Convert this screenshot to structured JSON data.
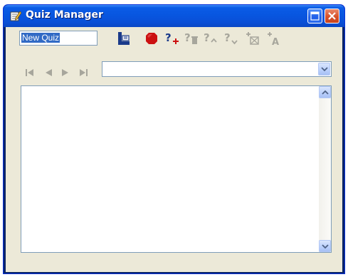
{
  "window": {
    "title": "Quiz Manager",
    "title_icon": "notepad-pencil-icon",
    "buttons": [
      "maximize",
      "close"
    ]
  },
  "quiz_name": {
    "value": "New Quiz",
    "selected": true
  },
  "toolbar": {
    "items": [
      {
        "name": "save-icon",
        "enabled": true
      },
      {
        "name": "stop-icon",
        "enabled": true
      },
      {
        "name": "add-question-icon",
        "enabled": true
      },
      {
        "name": "delete-question-icon",
        "enabled": false
      },
      {
        "name": "move-question-up-icon",
        "enabled": false
      },
      {
        "name": "move-question-down-icon",
        "enabled": false
      },
      {
        "name": "add-picture-icon",
        "enabled": false
      },
      {
        "name": "add-answer-icon",
        "enabled": false
      }
    ]
  },
  "navigation": {
    "items": [
      "first-icon",
      "previous-icon",
      "next-icon",
      "last-icon"
    ],
    "enabled": false
  },
  "question_select": {
    "value": ""
  },
  "colors": {
    "titlebar": "#0856e0",
    "client": "#ece9d8",
    "field_border": "#7f9db9",
    "selection": "#316ac5",
    "disabled_icon": "#a7a69c",
    "stop_red": "#cc1111",
    "save_blue": "#1a3a8a"
  }
}
